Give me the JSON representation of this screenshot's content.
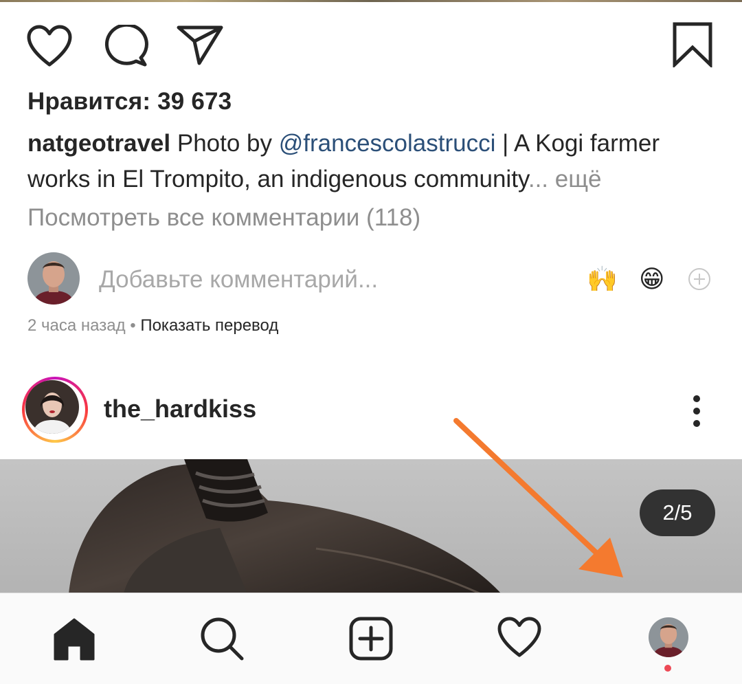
{
  "post": {
    "likes_text": "Нравится: 39 673",
    "caption": {
      "username": "natgeotravel",
      "text_before_mention": " Photo by ",
      "mention": "@francescolastrucci",
      "text_after_mention": " | A Kogi farmer works in El Trompito, an indigenous community",
      "ellipsis": "...",
      "more_label": " ещё"
    },
    "view_comments_label": "Посмотреть все комментарии (118)",
    "comment_placeholder": "Добавьте комментарий...",
    "quick_emojis": [
      "🙌",
      "😁"
    ],
    "timestamp": "2 часа назад",
    "meta_separator": " • ",
    "translate_label": "Показать перевод"
  },
  "next_post": {
    "username": "the_hardkiss",
    "carousel_counter": "2/5"
  },
  "icons": {
    "like": "heart-outline-icon",
    "comment": "speech-bubble-icon",
    "share": "paper-plane-icon",
    "save": "bookmark-icon",
    "more": "kebab-menu-icon",
    "add_emoji": "plus-circle-icon"
  },
  "bottom_nav": {
    "items": [
      "home-icon",
      "search-icon",
      "new-post-icon",
      "activity-heart-icon",
      "profile-avatar"
    ]
  },
  "colors": {
    "mention": "#2b4f78",
    "muted_text": "#8e8e8e",
    "annotation_arrow": "#f47a2f",
    "notification_dot": "#ed4956",
    "counter_bg": "#262626"
  }
}
